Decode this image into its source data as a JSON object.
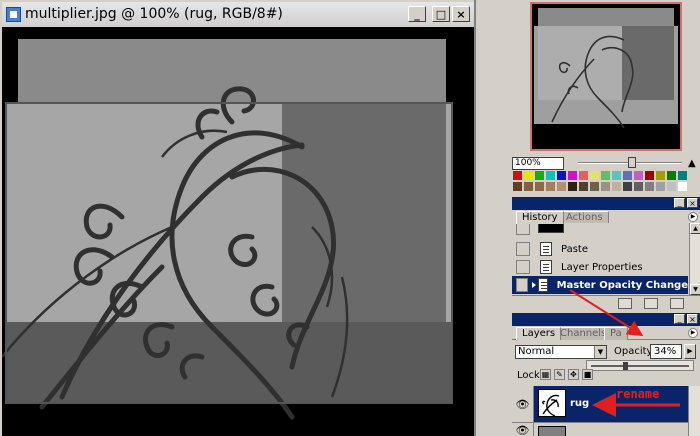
{
  "document": {
    "title": "multiplier.jpg @ 100% (rug, RGB/8#)",
    "window_buttons": [
      "_",
      "□",
      "×"
    ]
  },
  "navigator": {
    "zoom": "100%",
    "zoom_slider_value": 0.52,
    "mountain_icon": "mountain-icon"
  },
  "swatches": {
    "row1": [
      "#d01010",
      "#e6e600",
      "#10b010",
      "#10c0c0",
      "#1010d0",
      "#d010d0",
      "#e06060",
      "#e0e070",
      "#60c060",
      "#60c0c0",
      "#6070c0",
      "#c060c0",
      "#a00000",
      "#a0a000",
      "#008000",
      "#008080"
    ],
    "row2": [
      "#604020",
      "#806040",
      "#906848",
      "#a08060",
      "#b09070",
      "#302010",
      "#504030",
      "#706050",
      "#a09080",
      "#c0b0a0",
      "#404040",
      "#606060",
      "#808080",
      "#a0a0a0",
      "#c0c0c0",
      "#ffffff"
    ]
  },
  "history": {
    "tabs": [
      "History",
      "Actions"
    ],
    "items": [
      {
        "label": "Paste",
        "selected": false
      },
      {
        "label": "Layer Properties",
        "selected": false
      },
      {
        "label": "Master Opacity Change",
        "selected": true
      }
    ]
  },
  "layers": {
    "tabs": [
      "Layers",
      "Channels",
      "Pa"
    ],
    "blend_mode": "Normal",
    "opacity_label": "Opacity:",
    "opacity_value": "34%",
    "opacity_slider_value": 0.34,
    "lock_label": "Lock:",
    "layer_name": "rug"
  },
  "annotation": {
    "label": "rename",
    "color": "#e02020"
  }
}
